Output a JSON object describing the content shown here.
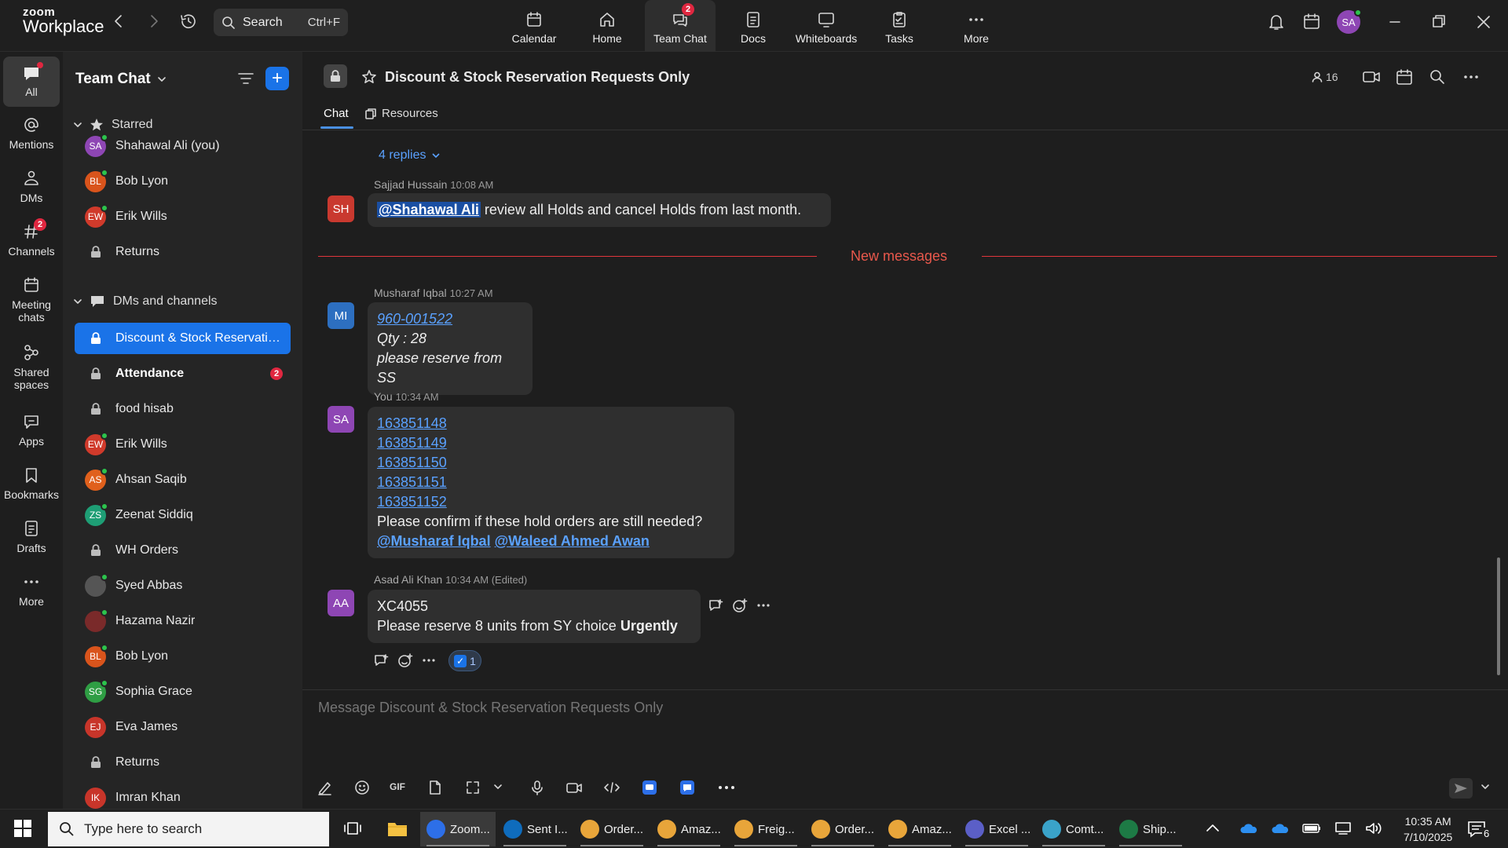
{
  "app": {
    "logo_top": "zoom",
    "logo_bottom": "Workplace"
  },
  "search": {
    "label": "Search",
    "shortcut": "Ctrl+F"
  },
  "top_tabs": [
    {
      "label": "Calendar",
      "icon": "calendar-icon"
    },
    {
      "label": "Home",
      "icon": "home-icon"
    },
    {
      "label": "Team Chat",
      "icon": "chat-icon",
      "badge": "2"
    },
    {
      "label": "Docs",
      "icon": "docs-icon"
    },
    {
      "label": "Whiteboards",
      "icon": "whiteboard-icon"
    },
    {
      "label": "Tasks",
      "icon": "tasks-icon"
    },
    {
      "label": "More",
      "icon": "more-icon"
    }
  ],
  "user": {
    "initials": "SA"
  },
  "rail": [
    {
      "label": "All",
      "icon": "chat-bubble-icon"
    },
    {
      "label": "Mentions",
      "icon": "at-icon"
    },
    {
      "label": "DMs",
      "icon": "people-icon"
    },
    {
      "label": "Channels",
      "icon": "hash-icon",
      "badge": "2"
    },
    {
      "label": "Meeting chats",
      "icon": "meeting-calendar-icon"
    },
    {
      "label": "Shared spaces",
      "icon": "shared-spaces-icon"
    },
    {
      "label": "Apps",
      "icon": "apps-icon"
    },
    {
      "label": "Bookmarks",
      "icon": "bookmark-icon"
    },
    {
      "label": "Drafts",
      "icon": "drafts-icon"
    },
    {
      "label": "More",
      "icon": "more-dots-icon"
    }
  ],
  "sidebar": {
    "title": "Team Chat",
    "starred_label": "Starred",
    "starred": [
      {
        "type": "avatar",
        "initials": "SA",
        "color": "#8e46b4",
        "name": "Shahawal Ali (you)",
        "online": true
      },
      {
        "type": "avatar",
        "initials": "BL",
        "color": "#d9541c",
        "name": "Bob Lyon",
        "online": true
      },
      {
        "type": "avatar",
        "initials": "EW",
        "color": "#d03a2b",
        "name": "Erik Wills",
        "online": true
      },
      {
        "type": "lock",
        "name": "Returns"
      }
    ],
    "dms_label": "DMs and channels",
    "dms": [
      {
        "type": "lock",
        "name": "Discount & Stock Reservatio...",
        "selected": true
      },
      {
        "type": "lock",
        "name": "Attendance",
        "bold": true,
        "count": "2"
      },
      {
        "type": "lock",
        "name": "food hisab"
      },
      {
        "type": "avatar",
        "initials": "EW",
        "color": "#d03a2b",
        "name": "Erik Wills",
        "online": true
      },
      {
        "type": "avatar",
        "initials": "AS",
        "color": "#e0601c",
        "name": "Ahsan Saqib",
        "online": true
      },
      {
        "type": "avatar",
        "initials": "ZS",
        "color": "#1e9e75",
        "name": "Zeenat Siddiq",
        "online": true
      },
      {
        "type": "lock",
        "name": "WH Orders"
      },
      {
        "type": "photo",
        "initials": "",
        "color": "#555555",
        "name": "Syed Abbas",
        "online": true
      },
      {
        "type": "photo",
        "initials": "",
        "color": "#7a2a2a",
        "name": "Hazama Nazir",
        "online": true
      },
      {
        "type": "avatar",
        "initials": "BL",
        "color": "#d9541c",
        "name": "Bob Lyon",
        "online": true
      },
      {
        "type": "avatar",
        "initials": "SG",
        "color": "#2f9e44",
        "name": "Sophia Grace",
        "online": true
      },
      {
        "type": "avatar",
        "initials": "EJ",
        "color": "#c8352a",
        "name": "Eva James",
        "online": false
      },
      {
        "type": "lock",
        "name": "Returns"
      },
      {
        "type": "avatar",
        "initials": "IK",
        "color": "#c8352a",
        "name": "Imran Khan",
        "online": false
      }
    ]
  },
  "channel": {
    "title": "Discount & Stock Reservation Requests Only",
    "tabs": [
      "Chat",
      "Resources"
    ],
    "member_count": "16"
  },
  "messages": {
    "replies_label": "4 replies",
    "new_messages_label": "New messages",
    "m1": {
      "initials": "SH",
      "color": "#c9392f",
      "author": "Sajjad Hussain",
      "time": "10:08 AM",
      "mention": "@Shahawal Ali",
      "text": " review all Holds and cancel Holds from last month."
    },
    "m2": {
      "initials": "MI",
      "color": "#2d6fc0",
      "author": "Musharaf Iqbal",
      "time": "10:27 AM",
      "link": "960-001522",
      "line2": "Qty : 28",
      "line3": "please reserve from SS"
    },
    "m3": {
      "initials": "SA",
      "color": "#8e46b4",
      "author": "You",
      "time": "10:34 AM",
      "links": [
        "163851148",
        "163851149",
        "163851150",
        "163851151",
        "163851152"
      ],
      "text": "Please confirm if these hold orders are still needed?",
      "mention1": "@Musharaf Iqbal",
      "mention2": "@Waleed Ahmed Awan"
    },
    "m4": {
      "initials": "AA",
      "color": "#8e46b4",
      "author": "Asad Ali Khan",
      "time": "10:34 AM (Edited)",
      "line1": "XC4055",
      "line2_plain": "Please reserve 8 units from SY choice ",
      "line2_bold": "Urgently",
      "reaction_count": "1"
    }
  },
  "composer": {
    "placeholder": "Message Discount & Stock Reservation Requests Only",
    "gif_label": "GIF"
  },
  "taskbar": {
    "search_placeholder": "Type here to search",
    "apps": [
      {
        "label": "Zoom...",
        "color": "#2d6fe8",
        "active": true
      },
      {
        "label": "Sent I...",
        "color": "#0f6cbd"
      },
      {
        "label": "Order...",
        "color": "#e8a53a"
      },
      {
        "label": "Amaz...",
        "color": "#e8a53a"
      },
      {
        "label": "Freig...",
        "color": "#e8a53a"
      },
      {
        "label": "Order...",
        "color": "#e8a53a"
      },
      {
        "label": "Amaz...",
        "color": "#e8a53a"
      },
      {
        "label": "Excel ...",
        "color": "#5b5fc7"
      },
      {
        "label": "Comt...",
        "color": "#3aa3c9"
      },
      {
        "label": "Ship...",
        "color": "#1d7a45"
      }
    ],
    "time": "10:35 AM",
    "date": "7/10/2025",
    "notif_count": "6"
  }
}
